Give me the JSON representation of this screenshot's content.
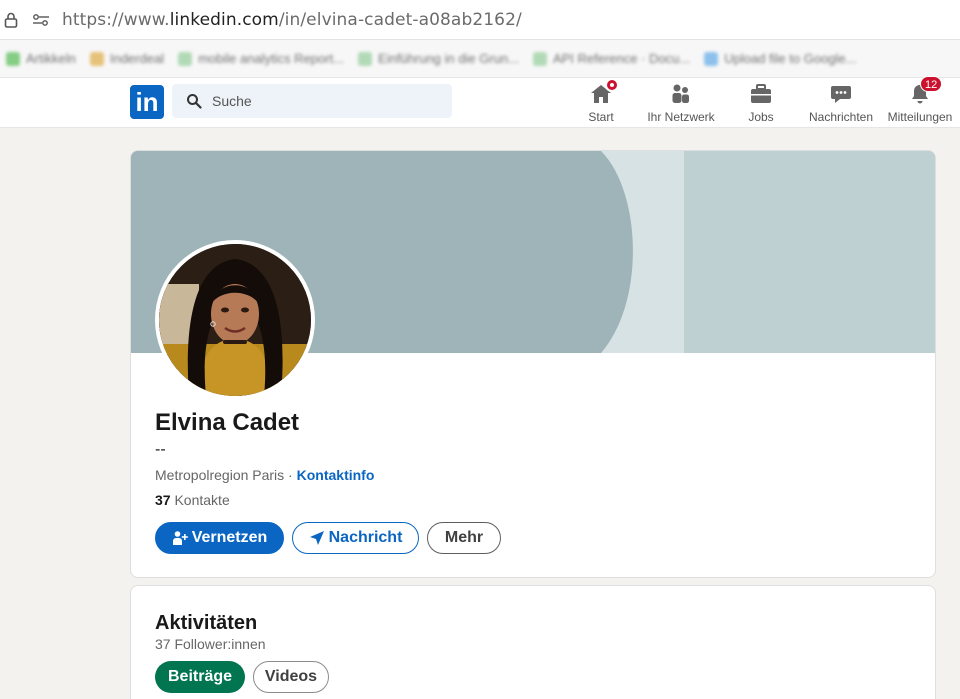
{
  "browser": {
    "url_prefix": "https://www.",
    "url_domain": "linkedin.com",
    "url_path": "/in/elvina-cadet-a08ab2162/",
    "bookmarks": [
      {
        "label": "Artikkeln",
        "color": "#5fbf5f"
      },
      {
        "label": "Inderdeal",
        "color": "#e0b050"
      },
      {
        "label": "mobile analytics Report...",
        "color": "#9ad0a0"
      },
      {
        "label": "Einführung in die Grun...",
        "color": "#9ad0a0"
      },
      {
        "label": "API Reference · Docu...",
        "color": "#9ad0a0"
      },
      {
        "label": "Upload file to Google...",
        "color": "#6aaee8"
      }
    ]
  },
  "nav": {
    "logo_text": "in",
    "search_placeholder": "Suche",
    "items": [
      {
        "label": "Start",
        "icon": "home-icon"
      },
      {
        "label": "Ihr Netzwerk",
        "icon": "network-icon"
      },
      {
        "label": "Jobs",
        "icon": "briefcase-icon"
      },
      {
        "label": "Nachrichten",
        "icon": "messaging-icon"
      },
      {
        "label": "Mitteilungen",
        "icon": "bell-icon"
      }
    ],
    "notifications_count": "12"
  },
  "profile": {
    "name": "Elvina Cadet",
    "headline": "--",
    "location": "Metropolregion Paris",
    "separator": " · ",
    "contact_info_label": "Kontaktinfo",
    "contacts_count": "37",
    "contacts_label": " Kontakte",
    "connect_label": "Vernetzen",
    "message_label": "Nachricht",
    "more_label": "Mehr"
  },
  "activity": {
    "title": "Aktivitäten",
    "followers": "37 Follower:innen",
    "tabs": [
      {
        "label": "Beiträge",
        "active": true
      },
      {
        "label": "Videos",
        "active": false
      }
    ]
  },
  "colors": {
    "brand": "#0a66c2",
    "banner": "#b8ccce",
    "active_pill": "#01754f",
    "notification": "#cb112d"
  }
}
